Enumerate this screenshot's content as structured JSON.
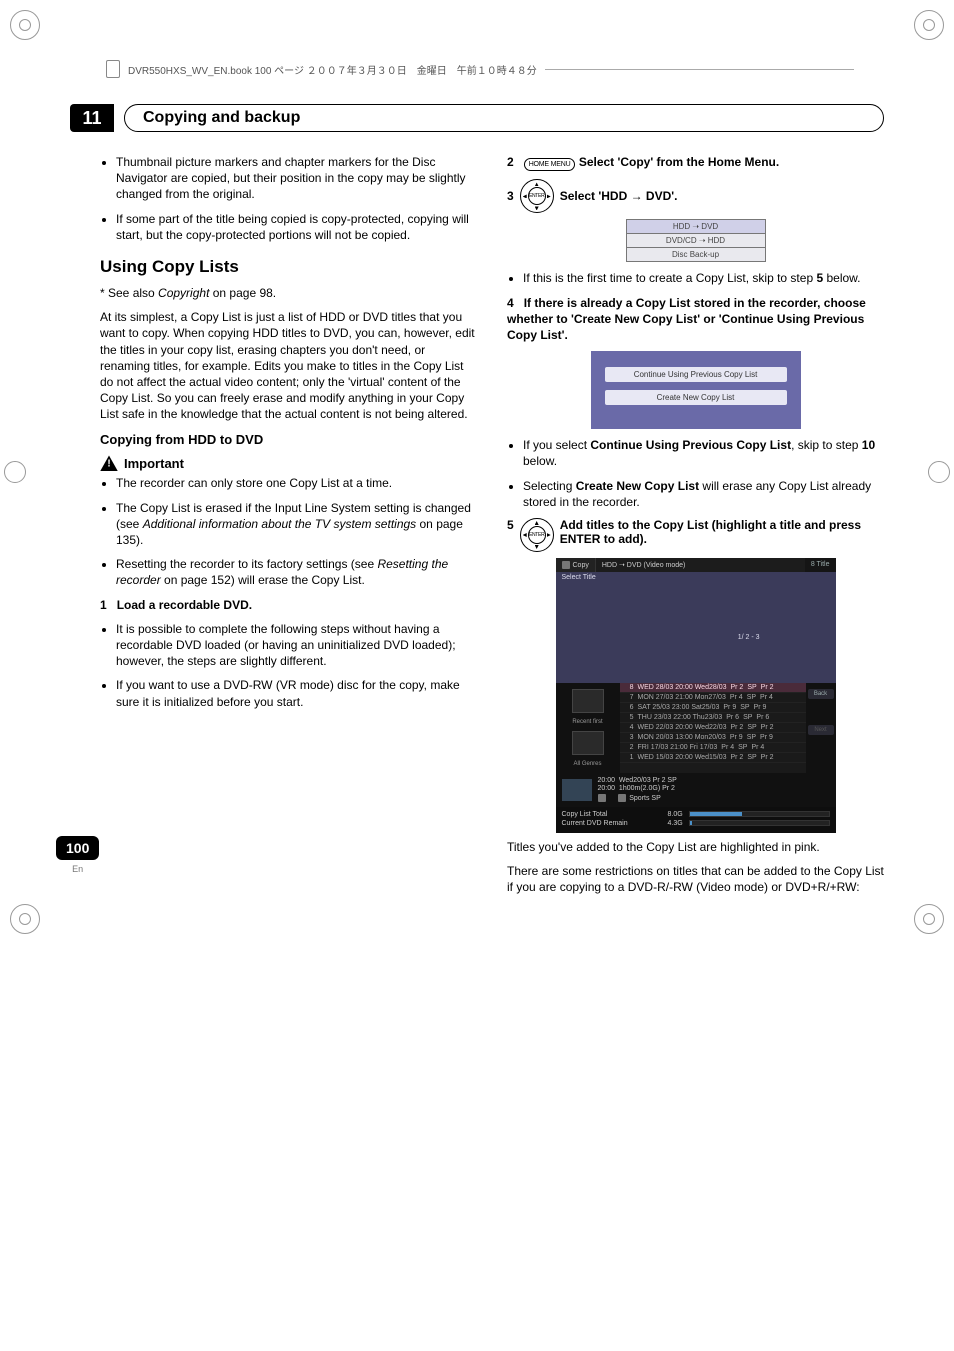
{
  "header": {
    "runner": "DVR550HXS_WV_EN.book  100 ページ  ２００７年３月３０日　金曜日　午前１０時４８分"
  },
  "chapter": {
    "num": "11",
    "title": "Copying and backup"
  },
  "left": {
    "bullets_top": [
      "Thumbnail picture markers and chapter markers for the Disc Navigator are copied, but their position in the copy may be slightly changed from the original.",
      "If some part of the title being copied is copy-protected, copying will start, but the copy-protected portions will not be copied."
    ],
    "h2": "Using Copy Lists",
    "see_also_pre": "* See also ",
    "see_also_ital": "Copyright",
    "see_also_post": " on page 98.",
    "body_para": "At its simplest, a Copy List is just a list of HDD or DVD titles that you want to copy. When copying HDD titles to DVD, you can, however, edit the titles in your copy list, erasing chapters you don't need, or renaming titles, for example. Edits you make to titles in the Copy List do not affect the actual video content; only the 'virtual' content of the Copy List. So you can freely erase and modify anything in your Copy List safe in the knowledge that the actual content is not being altered.",
    "h3": "Copying from HDD to DVD",
    "important_label": "Important",
    "important_items": [
      "The recorder can only store one Copy List at a time.",
      "The Copy List is erased if the Input Line System setting is changed (see <i>Additional information about the TV system settings</i> on page 135).",
      "Resetting the recorder to its factory settings (see <i>Resetting the recorder</i> on page 152) will erase the Copy List."
    ],
    "step1_num": "1",
    "step1_title": "Load a recordable DVD.",
    "step1_items": [
      "It is possible to complete the following steps without having a recordable DVD loaded (or having an uninitialized DVD loaded); however, the steps are slightly different.",
      "If you want to use a DVD-RW (VR mode) disc for the copy, make sure it is initialized before you start."
    ]
  },
  "right": {
    "step2_num": "2",
    "step2_pill": "HOME MENU",
    "step2_text": " Select 'Copy' from the Home Menu.",
    "step3_num": "3",
    "step3_enter": "ENTER",
    "step3_text": " Select 'HDD → DVD'.",
    "menu1": {
      "r1": "HDD ➝ DVD",
      "r2": "DVD/CD ➝ HDD",
      "r3": "Disc Back-up"
    },
    "step3_bullet": "If this is the first time to create a Copy List, skip to step <b>5</b> below.",
    "step4_num": "4",
    "step4_text": "If there is already a Copy List stored in the recorder, choose whether to 'Create New Copy List' or 'Continue Using Previous Copy List'.",
    "menu2": {
      "b1": "Continue Using Previous Copy List",
      "b2": "Create New Copy List"
    },
    "step4_bullets": [
      "If you select <b>Continue Using Previous Copy List</b>, skip to step <b>10</b> below.",
      "Selecting <b>Create New Copy List</b> will erase any Copy List already stored in the recorder."
    ],
    "step5_num": "5",
    "step5_enter": "ENTER",
    "step5_text": " Add titles to the Copy List (highlight a title and press ENTER to add).",
    "panel": {
      "tab_icon_label": "Copy",
      "mode": "HDD ➝ DVD (Video mode)",
      "count": "8  Title",
      "select_title": "Select Title",
      "pager": "1/  2 - 3",
      "side_recent": "Recent first",
      "side_genre_icon": "Genre",
      "side_all": "All Genres",
      "rows": [
        {
          "n": "8",
          "d": "WED 28/03 20:00 Wed28/03",
          "p": "Pr 2",
          "q": "SP",
          "r": "Pr 2"
        },
        {
          "n": "7",
          "d": "MON 27/03 21:00 Mon27/03",
          "p": "Pr 4",
          "q": "SP",
          "r": "Pr 4"
        },
        {
          "n": "6",
          "d": "SAT 25/03 23:00 Sat25/03",
          "p": "Pr 9",
          "q": "SP",
          "r": "Pr 9"
        },
        {
          "n": "5",
          "d": "THU 23/03 22:00 Thu23/03",
          "p": "Pr 6",
          "q": "SP",
          "r": "Pr 6"
        },
        {
          "n": "4",
          "d": "WED 22/03 20:00 Wed22/03",
          "p": "Pr 2",
          "q": "SP",
          "r": "Pr 2"
        },
        {
          "n": "3",
          "d": "MON 20/03 13:00 Mon20/03",
          "p": "Pr 9",
          "q": "SP",
          "r": "Pr 9"
        },
        {
          "n": "2",
          "d": "FRI 17/03 21:00 Fri 17/03",
          "p": "Pr 4",
          "q": "SP",
          "r": "Pr 4"
        },
        {
          "n": "1",
          "d": "WED 15/03 20:00 Wed15/03",
          "p": "Pr 2",
          "q": "SP",
          "r": "Pr 2"
        }
      ],
      "btn_back": "Back",
      "btn_next": "Next",
      "mid_time_a": "20:00",
      "mid_time_b": "20:00",
      "mid_date": "Wed20/03   Pr 2   SP",
      "mid_len": "1h00m(2.0G)             Pr 2",
      "mid_cat": "Sports      SP",
      "bot_total_lbl": "Copy List Total",
      "bot_total_val": "8.0G",
      "bot_remain_lbl": "Current DVD Remain",
      "bot_remain_val": "4.3G",
      "bot_fill_pct": 38
    },
    "after_para1": "Titles you've added to the Copy List are highlighted in pink.",
    "after_para2": "There are some restrictions on titles that can be added to the Copy List if you are copying to a DVD-R/-RW (Video mode) or DVD+R/+RW:"
  },
  "footer": {
    "page": "100",
    "lang": "En"
  }
}
